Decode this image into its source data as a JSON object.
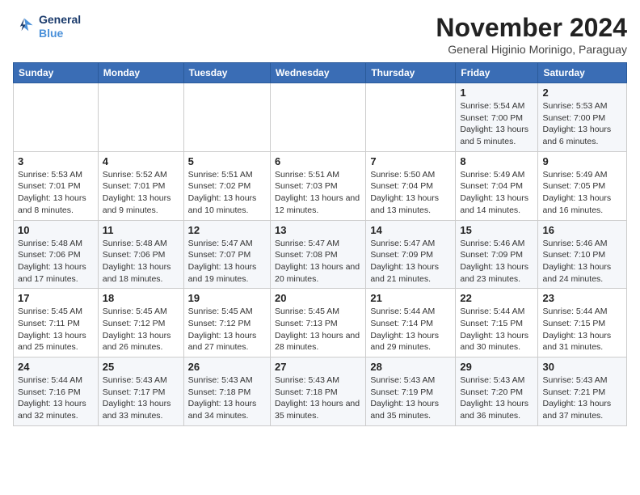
{
  "logo": {
    "line1": "General",
    "line2": "Blue"
  },
  "title": "November 2024",
  "subtitle": "General Higinio Morinigo, Paraguay",
  "weekdays": [
    "Sunday",
    "Monday",
    "Tuesday",
    "Wednesday",
    "Thursday",
    "Friday",
    "Saturday"
  ],
  "weeks": [
    [
      {
        "day": "",
        "info": ""
      },
      {
        "day": "",
        "info": ""
      },
      {
        "day": "",
        "info": ""
      },
      {
        "day": "",
        "info": ""
      },
      {
        "day": "",
        "info": ""
      },
      {
        "day": "1",
        "info": "Sunrise: 5:54 AM\nSunset: 7:00 PM\nDaylight: 13 hours and 5 minutes."
      },
      {
        "day": "2",
        "info": "Sunrise: 5:53 AM\nSunset: 7:00 PM\nDaylight: 13 hours and 6 minutes."
      }
    ],
    [
      {
        "day": "3",
        "info": "Sunrise: 5:53 AM\nSunset: 7:01 PM\nDaylight: 13 hours and 8 minutes."
      },
      {
        "day": "4",
        "info": "Sunrise: 5:52 AM\nSunset: 7:01 PM\nDaylight: 13 hours and 9 minutes."
      },
      {
        "day": "5",
        "info": "Sunrise: 5:51 AM\nSunset: 7:02 PM\nDaylight: 13 hours and 10 minutes."
      },
      {
        "day": "6",
        "info": "Sunrise: 5:51 AM\nSunset: 7:03 PM\nDaylight: 13 hours and 12 minutes."
      },
      {
        "day": "7",
        "info": "Sunrise: 5:50 AM\nSunset: 7:04 PM\nDaylight: 13 hours and 13 minutes."
      },
      {
        "day": "8",
        "info": "Sunrise: 5:49 AM\nSunset: 7:04 PM\nDaylight: 13 hours and 14 minutes."
      },
      {
        "day": "9",
        "info": "Sunrise: 5:49 AM\nSunset: 7:05 PM\nDaylight: 13 hours and 16 minutes."
      }
    ],
    [
      {
        "day": "10",
        "info": "Sunrise: 5:48 AM\nSunset: 7:06 PM\nDaylight: 13 hours and 17 minutes."
      },
      {
        "day": "11",
        "info": "Sunrise: 5:48 AM\nSunset: 7:06 PM\nDaylight: 13 hours and 18 minutes."
      },
      {
        "day": "12",
        "info": "Sunrise: 5:47 AM\nSunset: 7:07 PM\nDaylight: 13 hours and 19 minutes."
      },
      {
        "day": "13",
        "info": "Sunrise: 5:47 AM\nSunset: 7:08 PM\nDaylight: 13 hours and 20 minutes."
      },
      {
        "day": "14",
        "info": "Sunrise: 5:47 AM\nSunset: 7:09 PM\nDaylight: 13 hours and 21 minutes."
      },
      {
        "day": "15",
        "info": "Sunrise: 5:46 AM\nSunset: 7:09 PM\nDaylight: 13 hours and 23 minutes."
      },
      {
        "day": "16",
        "info": "Sunrise: 5:46 AM\nSunset: 7:10 PM\nDaylight: 13 hours and 24 minutes."
      }
    ],
    [
      {
        "day": "17",
        "info": "Sunrise: 5:45 AM\nSunset: 7:11 PM\nDaylight: 13 hours and 25 minutes."
      },
      {
        "day": "18",
        "info": "Sunrise: 5:45 AM\nSunset: 7:12 PM\nDaylight: 13 hours and 26 minutes."
      },
      {
        "day": "19",
        "info": "Sunrise: 5:45 AM\nSunset: 7:12 PM\nDaylight: 13 hours and 27 minutes."
      },
      {
        "day": "20",
        "info": "Sunrise: 5:45 AM\nSunset: 7:13 PM\nDaylight: 13 hours and 28 minutes."
      },
      {
        "day": "21",
        "info": "Sunrise: 5:44 AM\nSunset: 7:14 PM\nDaylight: 13 hours and 29 minutes."
      },
      {
        "day": "22",
        "info": "Sunrise: 5:44 AM\nSunset: 7:15 PM\nDaylight: 13 hours and 30 minutes."
      },
      {
        "day": "23",
        "info": "Sunrise: 5:44 AM\nSunset: 7:15 PM\nDaylight: 13 hours and 31 minutes."
      }
    ],
    [
      {
        "day": "24",
        "info": "Sunrise: 5:44 AM\nSunset: 7:16 PM\nDaylight: 13 hours and 32 minutes."
      },
      {
        "day": "25",
        "info": "Sunrise: 5:43 AM\nSunset: 7:17 PM\nDaylight: 13 hours and 33 minutes."
      },
      {
        "day": "26",
        "info": "Sunrise: 5:43 AM\nSunset: 7:18 PM\nDaylight: 13 hours and 34 minutes."
      },
      {
        "day": "27",
        "info": "Sunrise: 5:43 AM\nSunset: 7:18 PM\nDaylight: 13 hours and 35 minutes."
      },
      {
        "day": "28",
        "info": "Sunrise: 5:43 AM\nSunset: 7:19 PM\nDaylight: 13 hours and 35 minutes."
      },
      {
        "day": "29",
        "info": "Sunrise: 5:43 AM\nSunset: 7:20 PM\nDaylight: 13 hours and 36 minutes."
      },
      {
        "day": "30",
        "info": "Sunrise: 5:43 AM\nSunset: 7:21 PM\nDaylight: 13 hours and 37 minutes."
      }
    ]
  ]
}
